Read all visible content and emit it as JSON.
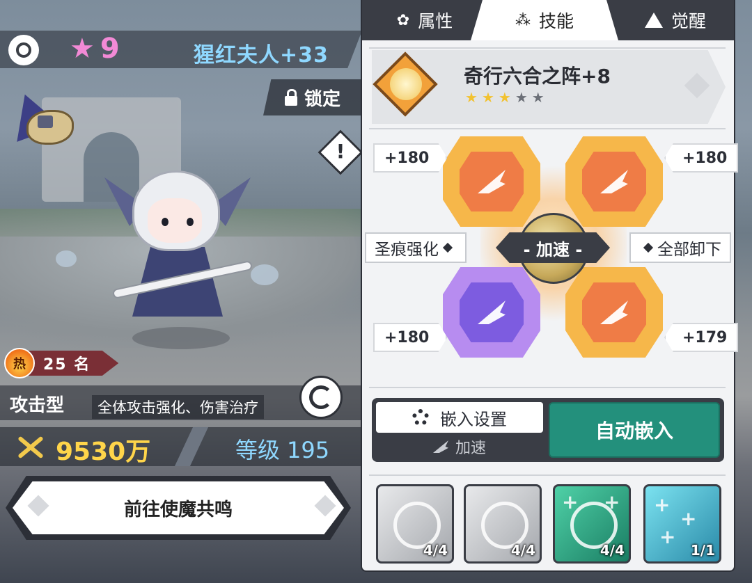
{
  "hero": {
    "star_glyph": "★",
    "star_level": "9",
    "name": "猩红夫人+33",
    "lock_label": "锁定",
    "heat_icon": "热",
    "heat_rank": "25 名",
    "type": "攻击型",
    "description": "全体攻击强化、伤害治疗",
    "power": "9530万",
    "level_label": "等级",
    "level_value": "195",
    "go_button": "前往使魔共鸣",
    "alert_glyph": "!"
  },
  "tabs": [
    {
      "icon": "attribute-icon",
      "label": "属性"
    },
    {
      "icon": "skill-icon",
      "label": "技能"
    },
    {
      "icon": "awaken-icon",
      "label": "觉醒"
    }
  ],
  "skill": {
    "name": "奇行六合之阵+8",
    "stars_filled": 3,
    "stars_total": 5,
    "star_glyph": "★"
  },
  "runes": {
    "center_label": "- 加速 -",
    "bonuses": {
      "top_left": "+180",
      "top_right": "+180",
      "bottom_left": "+180",
      "bottom_right": "+179"
    },
    "left_button": "圣痕强化",
    "right_button": "全部卸下"
  },
  "embed": {
    "settings_label": "嵌入设置",
    "settings_sub": "加速",
    "auto_label": "自动嵌入"
  },
  "slots": [
    {
      "count": "4/4",
      "style": "grey"
    },
    {
      "count": "4/4",
      "style": "grey"
    },
    {
      "count": "4/4",
      "style": "green"
    },
    {
      "count": "1/1",
      "style": "cyan"
    }
  ],
  "colors": {
    "name_blue": "#8fd8ff",
    "star_pink": "#f28ad6",
    "power_gold": "#ffd54a",
    "auto_green": "#23907c",
    "gem_orange": "#ef7c46",
    "gem_purple": "#7d5ce0"
  }
}
